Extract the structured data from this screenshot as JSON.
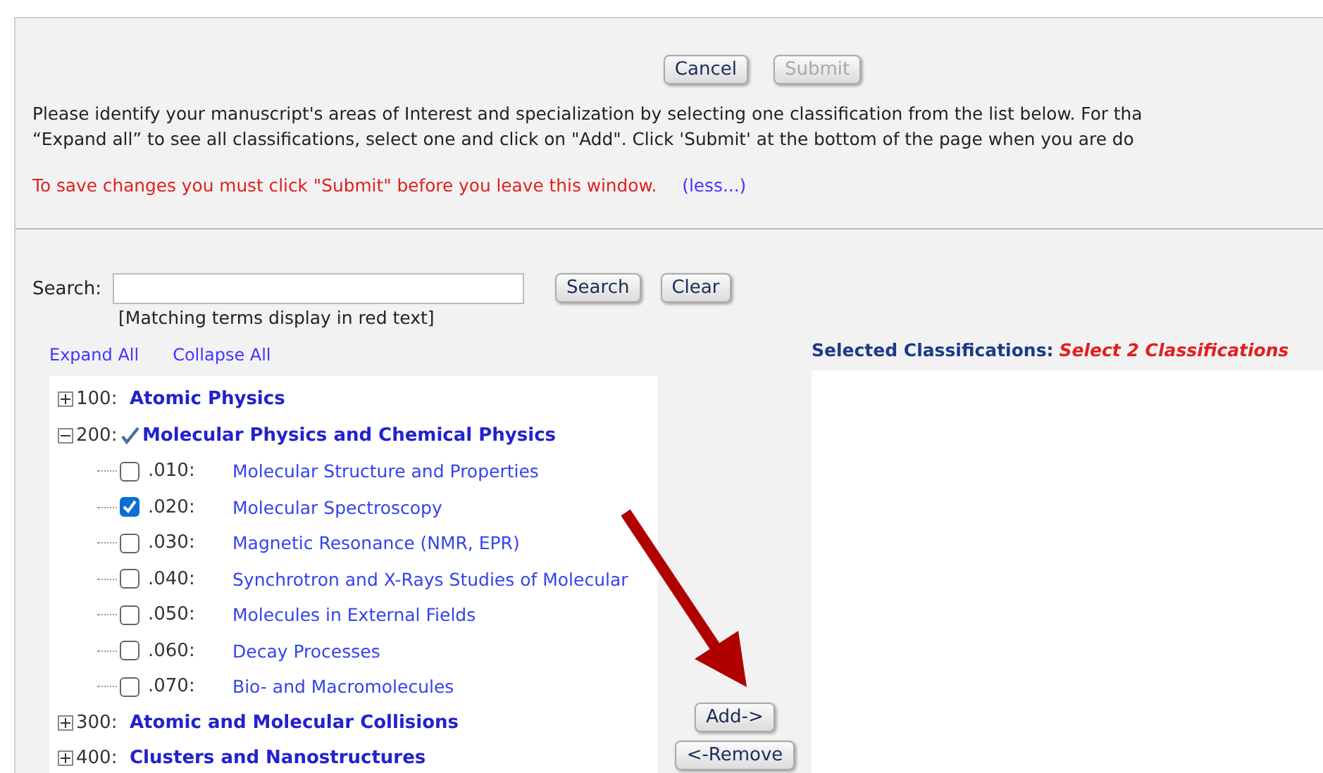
{
  "actions": [
    {
      "label": "Cancel",
      "disabled": false
    },
    {
      "label": "Submit",
      "disabled": true
    }
  ],
  "instructions": [
    "Please identify your manuscript's areas of Interest and specialization by selecting one classification from the list below. For tha",
    "“Expand all” to see all classifications, select one and click on \"Add\". Click 'Submit' at the bottom of the page when you are do"
  ],
  "warning": "To save changes you must click \"Submit\" before you leave this window.",
  "less_link": "(less...)",
  "search": {
    "label": "Search:",
    "hint": "[Matching terms display in red text]",
    "buttons": [
      "Search",
      "Clear"
    ]
  },
  "tree_links": [
    "Expand All",
    "Collapse All"
  ],
  "tree": [
    {
      "code": "100:",
      "title": "Atomic Physics",
      "expanded": false,
      "added": false
    },
    {
      "code": "200:",
      "title": "Molecular Physics and Chemical Physics",
      "expanded": true,
      "added": true,
      "children": [
        {
          "code": ".010:",
          "title": "Molecular Structure and Properties",
          "checked": false
        },
        {
          "code": ".020:",
          "title": "Molecular Spectroscopy",
          "checked": true
        },
        {
          "code": ".030:",
          "title": "Magnetic Resonance (NMR, EPR)",
          "checked": false
        },
        {
          "code": ".040:",
          "title": "Synchrotron and X-Rays Studies of Molecular",
          "checked": false
        },
        {
          "code": ".050:",
          "title": "Molecules in External Fields",
          "checked": false
        },
        {
          "code": ".060:",
          "title": "Decay Processes",
          "checked": false
        },
        {
          "code": ".070:",
          "title": "Bio- and Macromolecules",
          "checked": false
        }
      ]
    },
    {
      "code": "300:",
      "title": "Atomic and Molecular Collisions",
      "expanded": false,
      "added": false
    },
    {
      "code": "400:",
      "title": "Clusters and Nanostructures",
      "expanded": false,
      "added": false
    }
  ],
  "move_buttons": [
    "Add->",
    "<-Remove"
  ],
  "selected_panel": {
    "label": "Selected Classifications:",
    "note": "Select 2 Classifications"
  }
}
